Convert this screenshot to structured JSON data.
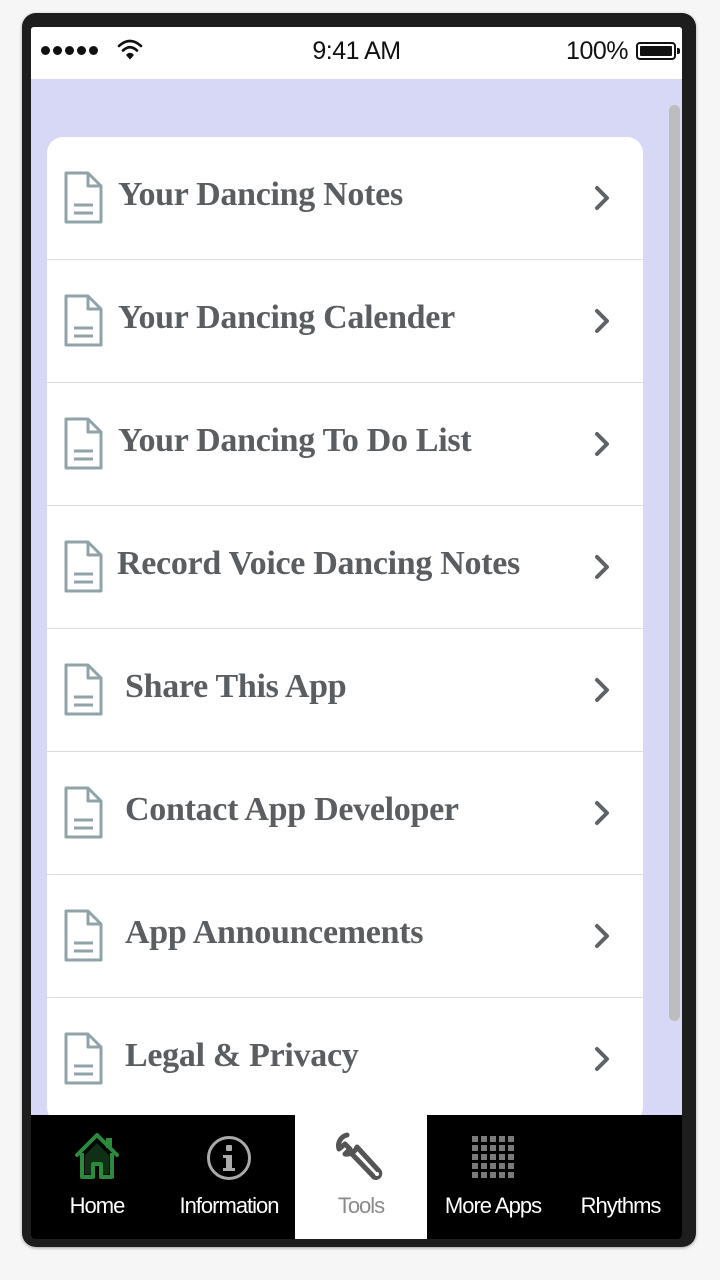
{
  "status_bar": {
    "time": "9:41 AM",
    "battery_percent": "100%"
  },
  "menu": {
    "items": [
      {
        "label": "Your Dancing Notes",
        "icon": "document-icon"
      },
      {
        "label": "Your Dancing Calender",
        "icon": "document-icon"
      },
      {
        "label": "Your Dancing To Do List",
        "icon": "document-icon"
      },
      {
        "label": "Record Voice Dancing Notes",
        "icon": "document-icon"
      },
      {
        "label": "Share This App",
        "icon": "document-icon"
      },
      {
        "label": "Contact App Developer",
        "icon": "document-icon"
      },
      {
        "label": "App Announcements",
        "icon": "document-icon"
      },
      {
        "label": "Legal & Privacy",
        "icon": "document-icon"
      }
    ]
  },
  "tab_bar": {
    "tabs": [
      {
        "label": "Home",
        "icon": "home-icon",
        "active": false
      },
      {
        "label": "Information",
        "icon": "info-icon",
        "active": false
      },
      {
        "label": "Tools",
        "icon": "wrench-icon",
        "active": true
      },
      {
        "label": "More Apps",
        "icon": "grid-icon",
        "active": false
      },
      {
        "label": "Rhythms",
        "icon": "",
        "active": false
      }
    ]
  },
  "colors": {
    "screen_background": "#d7d8f5",
    "item_text": "#5a5e61",
    "icon_stroke": "#8fa3a8",
    "home_icon_green": "#2c8a3c",
    "tab_bar_background": "#000000",
    "active_tab_background": "#ffffff"
  }
}
